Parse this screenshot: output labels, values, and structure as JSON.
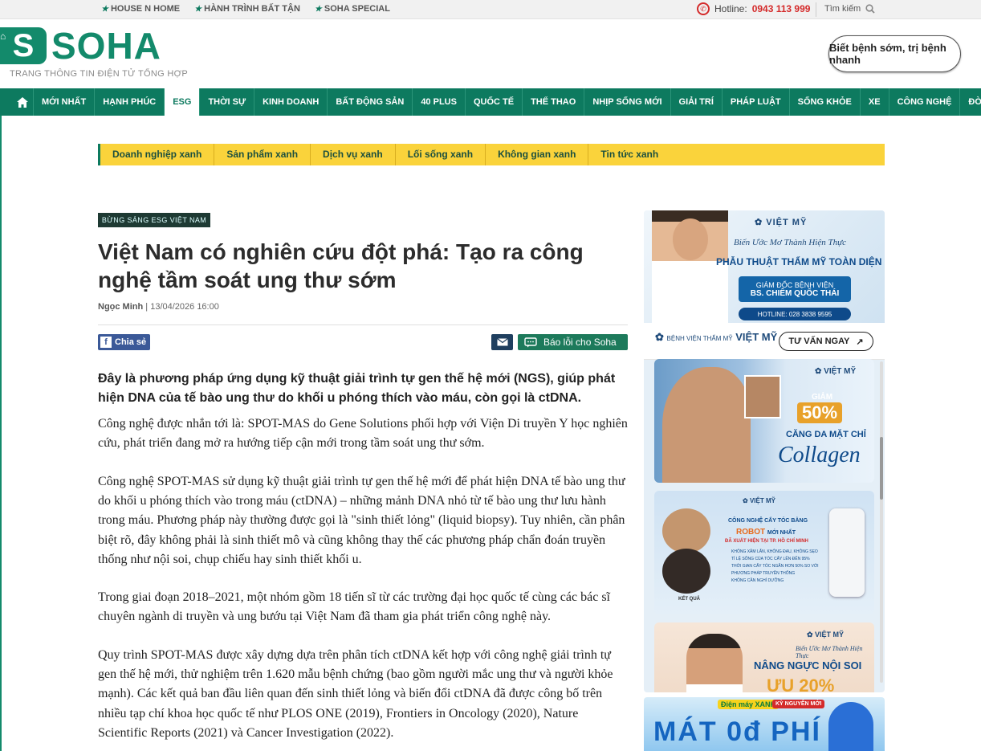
{
  "topbar": {
    "links": [
      "HOUSE N HOME",
      "HÀNH TRÌNH BẤT TẬN",
      "SOHA SPECIAL"
    ],
    "hotline_label": "Hotline:",
    "hotline_number": "0943 113 999",
    "search_label": "Tìm kiếm"
  },
  "header": {
    "logo_mark": "S",
    "logo_text": "SOHA",
    "slogan": "TRANG THÔNG TIN ĐIỆN TỬ TỔNG HỢP",
    "promo": "Biết bệnh sớm, trị bệnh nhanh"
  },
  "nav": {
    "items": [
      "MỚI NHẤT",
      "HẠNH PHÚC",
      "ESG",
      "THỜI SỰ",
      "KINH DOANH",
      "BẤT ĐỘNG SẢN",
      "40 PLUS",
      "QUỐC TẾ",
      "THỂ THAO",
      "NHỊP SỐNG MỚI",
      "GIẢI TRÍ",
      "PHÁP LUẬT",
      "SỐNG KHỎE",
      "XE",
      "CÔNG NGHỆ",
      "ĐỜI SỐNG"
    ],
    "active": "ESG"
  },
  "subnav": [
    "Doanh nghiệp xanh",
    "Sản phẩm xanh",
    "Dịch vụ xanh",
    "Lối sống xanh",
    "Không gian xanh",
    "Tin tức xanh"
  ],
  "article": {
    "badge": "BỪNG SÁNG ESG VIỆT NAM",
    "title": "Việt Nam có nghiên cứu đột phá: Tạo ra công nghệ tầm soát ung thư sớm",
    "author": "Ngọc Minh",
    "date": "13/04/2026 16:00",
    "share_label": "Chia sẻ",
    "report_label": "Báo lỗi cho Soha",
    "sapo": "Đây là phương pháp ứng dụng kỹ thuật giải trình tự gen thế hệ mới (NGS), giúp phát hiện DNA của tế bào ung thư do khối u phóng thích vào máu, còn gọi là ctDNA.",
    "paragraphs": [
      "Công nghệ được nhắn tới là: SPOT-MAS do Gene Solutions phối hợp với Viện Di truyền Y học nghiên cứu, phát triển đang mở ra hướng tiếp cận mới trong tầm soát ung thư sớm.",
      "Công nghệ SPOT-MAS sử dụng kỹ thuật giải trình tự gen thế hệ mới để phát hiện DNA tế bào ung thư do khối u phóng thích vào trong máu (ctDNA) – những mảnh DNA nhỏ từ tế bào ung thư lưu hành trong máu. Phương pháp này thường được gọi là \"sinh thiết lỏng\" (liquid biopsy). Tuy nhiên, cần phân biệt rõ, đây không phải là sinh thiết mô và cũng không thay thế các phương pháp chẩn đoán truyền thống như nội soi, chụp chiếu hay sinh thiết khối u.",
      "Trong giai đoạn 2018–2021, một nhóm gồm 18 tiến sĩ từ các trường đại học quốc tế cùng các bác sĩ chuyên ngành di truyền và ung bướu tại Việt Nam đã tham gia phát triển công nghệ này.",
      "Quy trình SPOT-MAS được xây dựng dựa trên phân tích ctDNA kết hợp với công nghệ giải trình tự gen thế hệ mới, thử nghiệm trên 1.620 mẫu bệnh chứng (bao gồm người mắc ung thư và người khỏe mạnh). Các kết quả ban đầu liên quan đến sinh thiết lỏng và biến đổi ctDNA đã được công bố trên nhiều tạp chí khoa học quốc tế như PLOS ONE (2019), Frontiers in Oncology (2020), Nature Scientific Reports (2021) và Cancer Investigation (2022)."
    ]
  },
  "ad": {
    "brand": "VIỆT MỸ",
    "brand_small": "BỆNH VIỆN THẨM MỸ",
    "tagline": "Biến Ước Mơ Thành Hiện Thực",
    "headline": "PHẪU THUẬT THẨM MỸ TOÀN DIỆN",
    "director_title": "GIÁM ĐỐC BỆNH VIỆN",
    "director_name": "BS. CHIÊM QUỐC THÁI",
    "hotline": "HOTLINE: 028 3838 9595",
    "cta": "TƯ VẤN NGAY",
    "card1_discount_label": "GIẢM",
    "card1_discount": "50%",
    "card1_line1": "CĂNG DA MẶT CHỈ",
    "card1_line2": "Collagen",
    "card2_line1": "CÔNG NGHỆ CẤY TÓC BẰNG",
    "card2_robot": "ROBOT",
    "card2_robot_suffix": "MỚI NHẤT",
    "card2_line3": "ĐÃ XUẤT HIỆN TẠI TP. HỒ CHÍ MINH",
    "card2_bullets": [
      "KHÔNG XÂM LẤN, KHÔNG ĐAU, KHÔNG SẸO",
      "TỈ LỆ SỐNG CỦA TÓC CẤY LÊN ĐẾN 95%",
      "THỜI GIAN CẤY TÓC NGẮN HƠN 50% SO VỚI PHƯƠNG PHÁP TRUYỀN THỐNG",
      "KHÔNG CẦN NGHỈ DƯỠNG"
    ],
    "card2_result": "KẾT QUẢ",
    "card3_line1": "NÂNG NGỰC NỘI SOI",
    "card3_discount": "ƯU 20%"
  },
  "ad2": {
    "brand": "Điện máy XANH",
    "badge": "KỲ NGUYÊN MỚI",
    "headline": "MÁT 0đ PHÍ"
  },
  "colors": {
    "brand_green": "#0d7a5f",
    "subnav_yellow": "#fad33b",
    "hotline_red": "#d42a2a"
  }
}
